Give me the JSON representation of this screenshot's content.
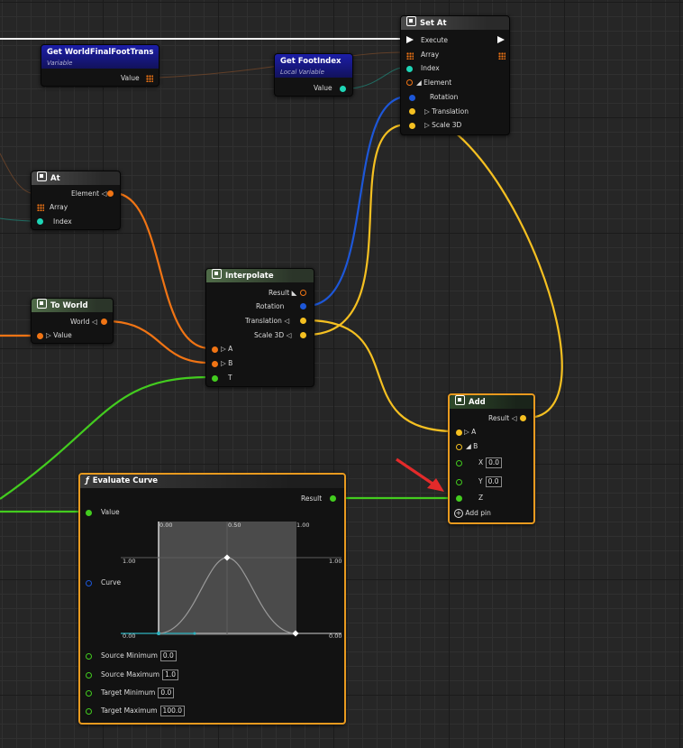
{
  "nodes": {
    "set_at": {
      "title": "Set At",
      "execute": "Execute",
      "array": "Array",
      "index": "Index",
      "element": "Element",
      "rotation": "Rotation",
      "translation": "Translation",
      "scale": "Scale 3D"
    },
    "get_world_final": {
      "title": "Get WorldFinalFootTrans",
      "subtitle": "Variable",
      "value": "Value"
    },
    "get_foot_index": {
      "title": "Get FootIndex",
      "subtitle": "Local Variable",
      "value": "Value"
    },
    "at": {
      "title": "At",
      "element": "Element",
      "array": "Array",
      "index": "Index"
    },
    "to_world": {
      "title": "To World",
      "world": "World",
      "value": "Value"
    },
    "interpolate": {
      "title": "Interpolate",
      "result": "Result",
      "rotation": "Rotation",
      "translation": "Translation",
      "scale": "Scale 3D",
      "a": "A",
      "b": "B",
      "t": "T"
    },
    "add": {
      "title": "Add",
      "result": "Result",
      "a": "A",
      "b": "B",
      "x": "X",
      "x_val": "0.0",
      "y": "Y",
      "y_val": "0.0",
      "z": "Z",
      "add_pin": "Add pin"
    },
    "evaluate_curve": {
      "title": "Evaluate Curve",
      "result": "Result",
      "value": "Value",
      "curve": "Curve",
      "src_min": "Source Minimum",
      "src_min_val": "0.0",
      "src_max": "Source Maximum",
      "src_max_val": "1.0",
      "tgt_min": "Target Minimum",
      "tgt_min_val": "0.0",
      "tgt_max": "Target Maximum",
      "tgt_max_val": "100.0",
      "graph": {
        "top_left": "0.00",
        "top_mid": "0.50",
        "top_right": "1.00",
        "left_mid": "1.00",
        "right_mid": "1.00",
        "bottom_left": "0.00",
        "bottom_right": "0.00"
      }
    }
  },
  "colors": {
    "vector": "#f5c021",
    "struct": "#f07414",
    "int": "#1ed5b6",
    "float": "#43cc1f",
    "rotator": "#1d57d8",
    "exec": "#ffffff",
    "highlight": "#e89a1f",
    "arrow": "#e32a2a"
  }
}
